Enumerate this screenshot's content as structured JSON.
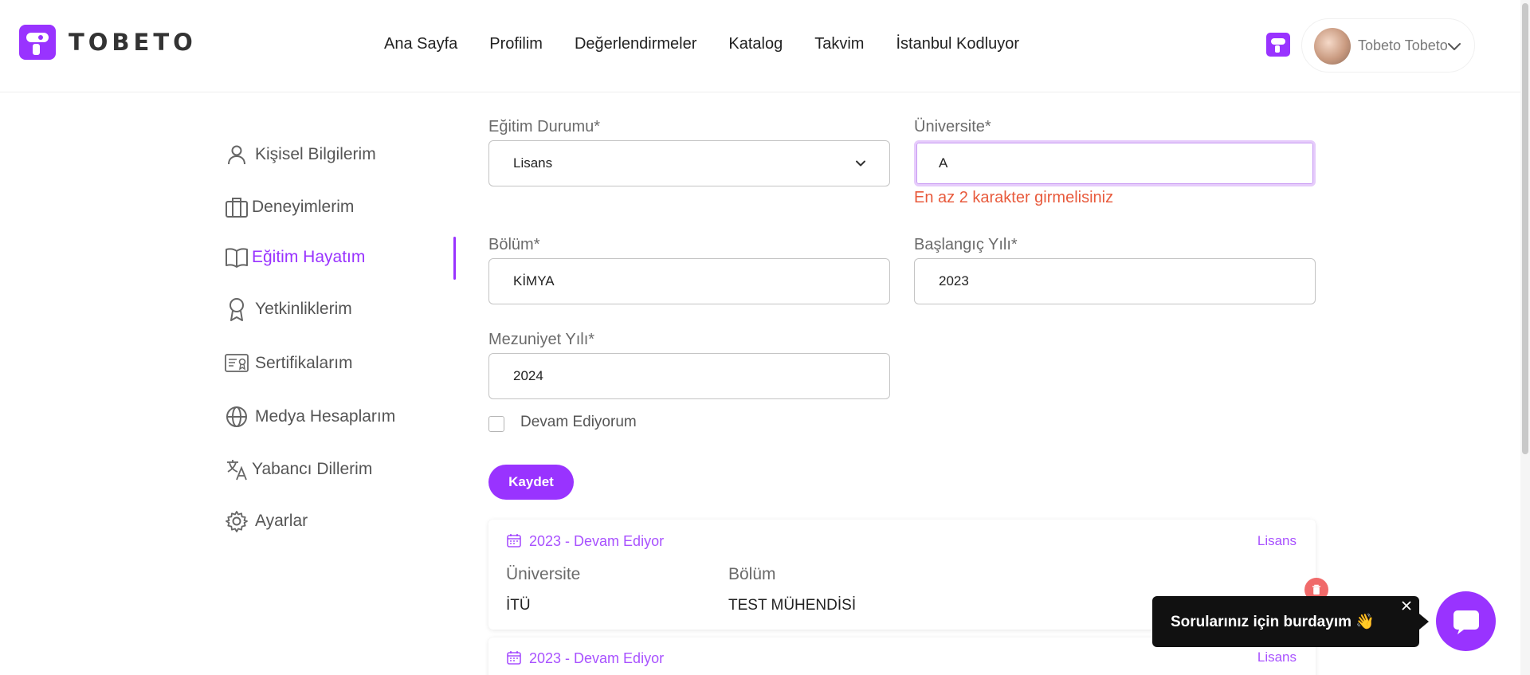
{
  "header": {
    "logo_text": "TOBETO",
    "nav": [
      "Ana Sayfa",
      "Profilim",
      "Değerlendirmeler",
      "Katalog",
      "Takvim",
      "İstanbul Kodluyor"
    ],
    "user_name": "Tobeto Tobeto"
  },
  "sidebar": {
    "items": [
      {
        "label": "Kişisel Bilgilerim",
        "icon": "user-icon"
      },
      {
        "label": "Deneyimlerim",
        "icon": "briefcase-icon"
      },
      {
        "label": "Eğitim Hayatım",
        "icon": "book-icon",
        "active": true
      },
      {
        "label": "Yetkinliklerim",
        "icon": "award-icon"
      },
      {
        "label": "Sertifikalarım",
        "icon": "certificate-icon"
      },
      {
        "label": "Medya Hesaplarım",
        "icon": "globe-icon"
      },
      {
        "label": "Yabancı Dillerim",
        "icon": "translate-icon"
      },
      {
        "label": "Ayarlar",
        "icon": "gear-icon"
      }
    ]
  },
  "form": {
    "education_label": "Eğitim Durumu*",
    "education_value": "Lisans",
    "university_label": "Üniversite*",
    "university_value": "A",
    "university_error": "En az 2 karakter girmelisiniz",
    "department_label": "Bölüm*",
    "department_value": "KİMYA",
    "start_label": "Başlangıç Yılı*",
    "start_value": "2023",
    "grad_label": "Mezuniyet Yılı*",
    "grad_value": "2024",
    "continuing_label": "Devam Ediyorum",
    "save_label": "Kaydet"
  },
  "records": [
    {
      "date": "2023 - Devam Ediyor",
      "degree": "Lisans",
      "university_header": "Üniversite",
      "department_header": "Bölüm",
      "university": "İTÜ",
      "department": "TEST MÜHENDİSİ"
    },
    {
      "date": "2023 - Devam Ediyor",
      "degree": "Lisans"
    }
  ],
  "chat": {
    "bubble_text": "Sorularınız için burdayım 👋"
  },
  "colors": {
    "accent": "#9933ff",
    "error": "#e85a3c",
    "danger": "#f06a6a"
  }
}
